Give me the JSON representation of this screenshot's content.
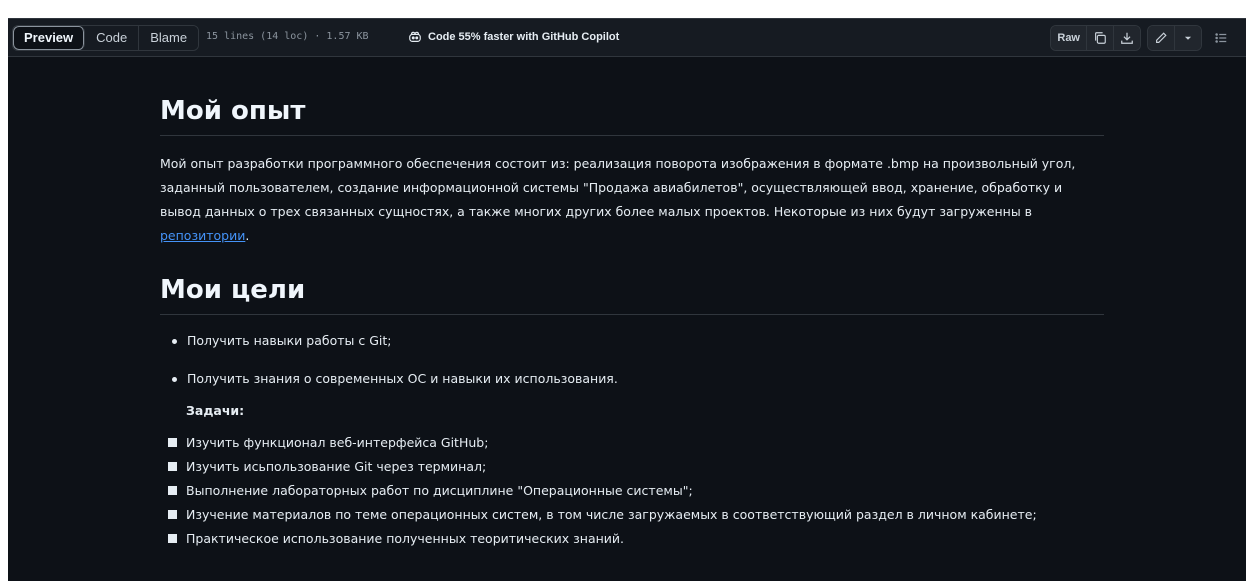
{
  "toolbar": {
    "tabs": [
      {
        "label": "Preview",
        "active": true
      },
      {
        "label": "Code",
        "active": false
      },
      {
        "label": "Blame",
        "active": false
      }
    ],
    "file_info": "15 lines (14 loc) · 1.57 KB",
    "copilot_text": "Code 55% faster with GitHub Copilot",
    "raw_label": "Raw",
    "icons": [
      "copy-icon",
      "download-icon",
      "pencil-icon",
      "triangle-down-icon",
      "list-unordered-icon"
    ]
  },
  "readme": {
    "section1": {
      "heading": "Мой опыт",
      "paragraph_before_link": "Мой опыт разработки программного обеспечения состоит из: реализация поворота изображения в формате .bmp на произвольный угол, заданный пользователем, создание информационной системы \"Продажа авиабилетов\", осуществляющей ввод, хранение, обработку и вывод данных о трех связанных сущностях, а также многих других более малых проектов. Некоторые из них будут загруженны в ",
      "link_text": "репозитории",
      "paragraph_after_link": "."
    },
    "section2": {
      "heading": "Мои цели",
      "goals": [
        "Получить навыки работы с Git;",
        "Получить знания о современных ОС и навыки их использования."
      ],
      "tasks_heading": "Задачи:",
      "tasks": [
        "Изучить функционал веб-интерфейса GitHub;",
        "Изучить исьпользование Git через терминал;",
        "Выполнение лабораторных работ по дисциплине \"Операционные системы\";",
        "Изучение материалов по теме операционных систем, в том числе загружаемых в соответствующий раздел в личном кабинете;",
        "Практическое использование полученных теоритических знаний."
      ]
    }
  }
}
